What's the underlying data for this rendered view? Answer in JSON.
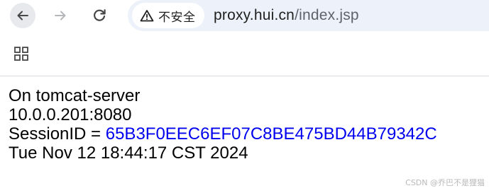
{
  "toolbar": {
    "back_icon": "arrow-left-icon",
    "forward_icon": "arrow-right-icon",
    "reload_icon": "reload-icon",
    "apps_icon": "apps-grid-icon"
  },
  "address_bar": {
    "security_label": "不安全",
    "security_icon": "warning-triangle-icon",
    "url_host": "proxy.hui.cn",
    "url_path": "/index.jsp"
  },
  "page": {
    "server_line": "On tomcat-server",
    "address_line": "10.0.0.201:8080",
    "session_prefix": "SessionID = ",
    "session_id": "65B3F0EEC6EF07C8BE475BD44B79342C",
    "timestamp": "Tue Nov 12 18:44:17 CST 2024"
  },
  "watermark": {
    "text": "CSDN @乔巴不是狸猫"
  },
  "colors": {
    "omnibox_bg": "#edf2fa",
    "link": "#0000ee",
    "back_button_bg": "#e7e9ec"
  }
}
